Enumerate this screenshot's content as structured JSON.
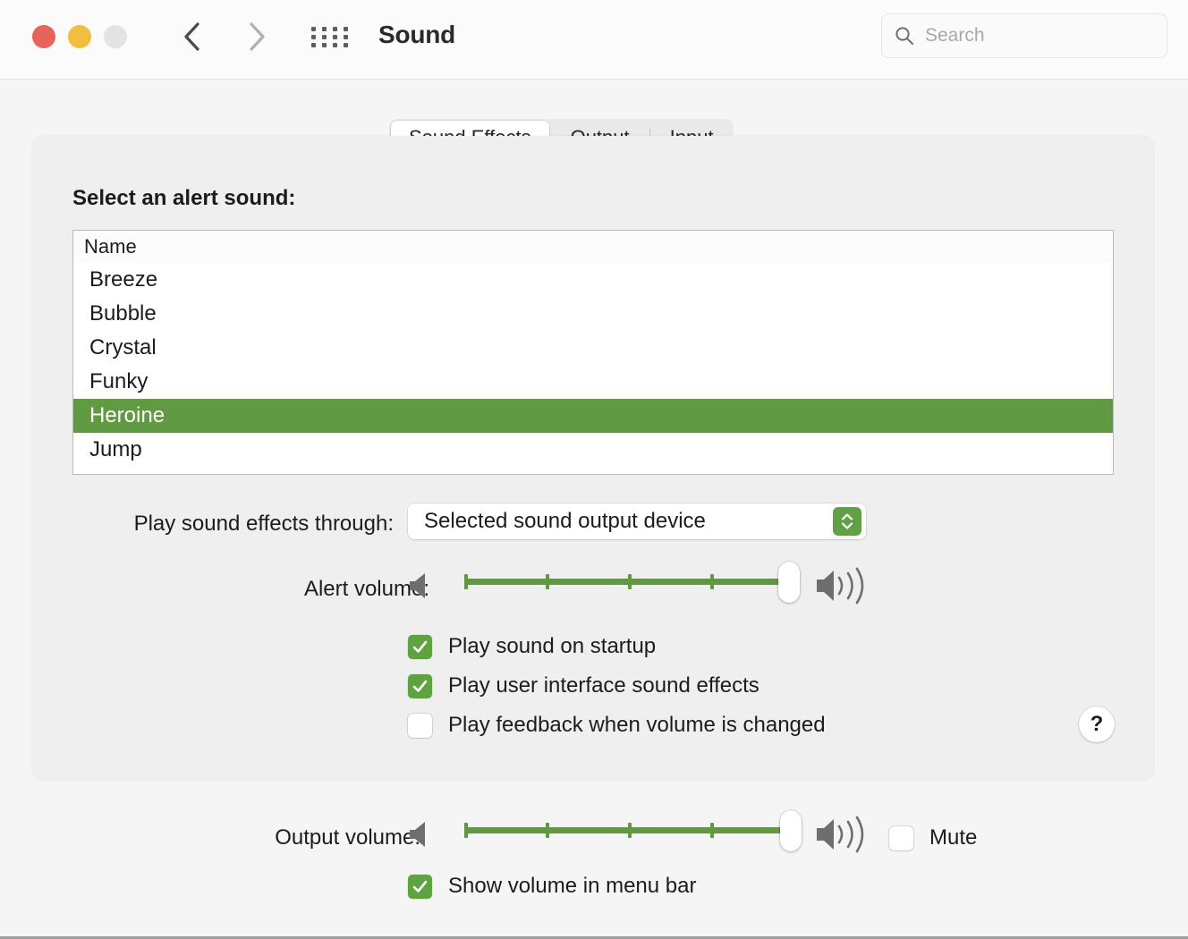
{
  "window": {
    "title": "Sound",
    "traffic_lights": [
      {
        "name": "close",
        "color": "#e8635a"
      },
      {
        "name": "minimize",
        "color": "#f2be3f"
      },
      {
        "name": "zoom",
        "color": "#e3e3e3"
      }
    ],
    "nav": {
      "back_icon": "chevron-left-icon",
      "forward_icon": "chevron-right-icon"
    },
    "grid_icon": "grid-apps-icon"
  },
  "search": {
    "placeholder": "Search",
    "value": "",
    "icon": "search-icon"
  },
  "tabs": [
    {
      "label": "Sound Effects",
      "active": true
    },
    {
      "label": "Output",
      "active": false
    },
    {
      "label": "Input",
      "active": false
    }
  ],
  "sound_effects": {
    "section_title": "Select an alert sound:",
    "list": {
      "column_header": "Name",
      "rows": [
        {
          "name": "Breeze",
          "selected": false
        },
        {
          "name": "Bubble",
          "selected": false
        },
        {
          "name": "Crystal",
          "selected": false
        },
        {
          "name": "Funky",
          "selected": false
        },
        {
          "name": "Heroine",
          "selected": true
        },
        {
          "name": "Jump",
          "selected": false
        }
      ],
      "selection_color": "#609a43"
    },
    "play_through": {
      "label": "Play sound effects through:",
      "value": "Selected sound output device",
      "stepper_icon": "chevron-up-down-icon",
      "stepper_color": "#62a046"
    },
    "alert_volume": {
      "label": "Alert volume:",
      "value_percent": 95,
      "ticks": 5,
      "track_color": "#5f9a3f",
      "min_icon": "speaker-mute-icon",
      "max_icon": "speaker-loud-icon"
    },
    "checkboxes": [
      {
        "label": "Play sound on startup",
        "checked": true
      },
      {
        "label": "Play user interface sound effects",
        "checked": true
      },
      {
        "label": "Play feedback when volume is changed",
        "checked": false
      }
    ],
    "help_label": "?"
  },
  "output": {
    "volume": {
      "label": "Output volume:",
      "value_percent": 96,
      "ticks": 5,
      "track_color": "#5f9a3f",
      "min_icon": "speaker-mute-icon",
      "max_icon": "speaker-loud-icon"
    },
    "mute": {
      "label": "Mute",
      "checked": false
    },
    "show_in_menu_bar": {
      "label": "Show volume in menu bar",
      "checked": true
    }
  }
}
